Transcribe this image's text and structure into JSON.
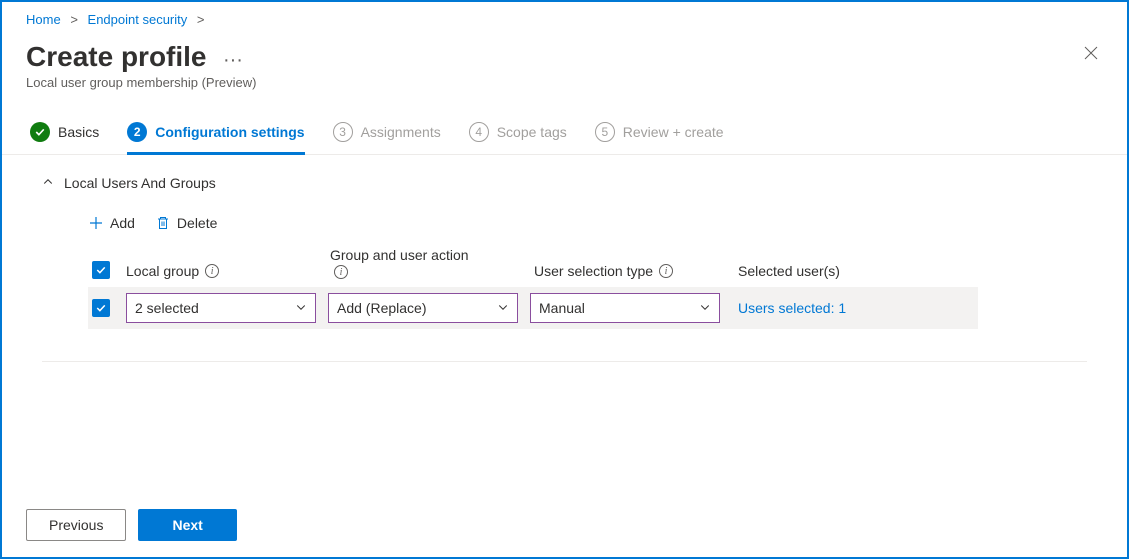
{
  "breadcrumbs": {
    "home": "Home",
    "endpoint_security": "Endpoint security"
  },
  "header": {
    "title": "Create profile",
    "subtitle": "Local user group membership (Preview)"
  },
  "tabs": {
    "basics": "Basics",
    "config": "Configuration settings",
    "assignments": "Assignments",
    "scope": "Scope tags",
    "review": "Review + create",
    "num2": "2",
    "num3": "3",
    "num4": "4",
    "num5": "5"
  },
  "section": {
    "title": "Local Users And Groups"
  },
  "toolbar": {
    "add": "Add",
    "delete": "Delete"
  },
  "columns": {
    "local_group": "Local group",
    "group_action": "Group and user action",
    "user_selection": "User selection type",
    "selected_users": "Selected user(s)"
  },
  "row": {
    "local_group_value": "2 selected",
    "action_value": "Add (Replace)",
    "user_sel_value": "Manual",
    "selected_link": "Users selected: 1"
  },
  "footer": {
    "previous": "Previous",
    "next": "Next"
  },
  "info_glyph": "i"
}
